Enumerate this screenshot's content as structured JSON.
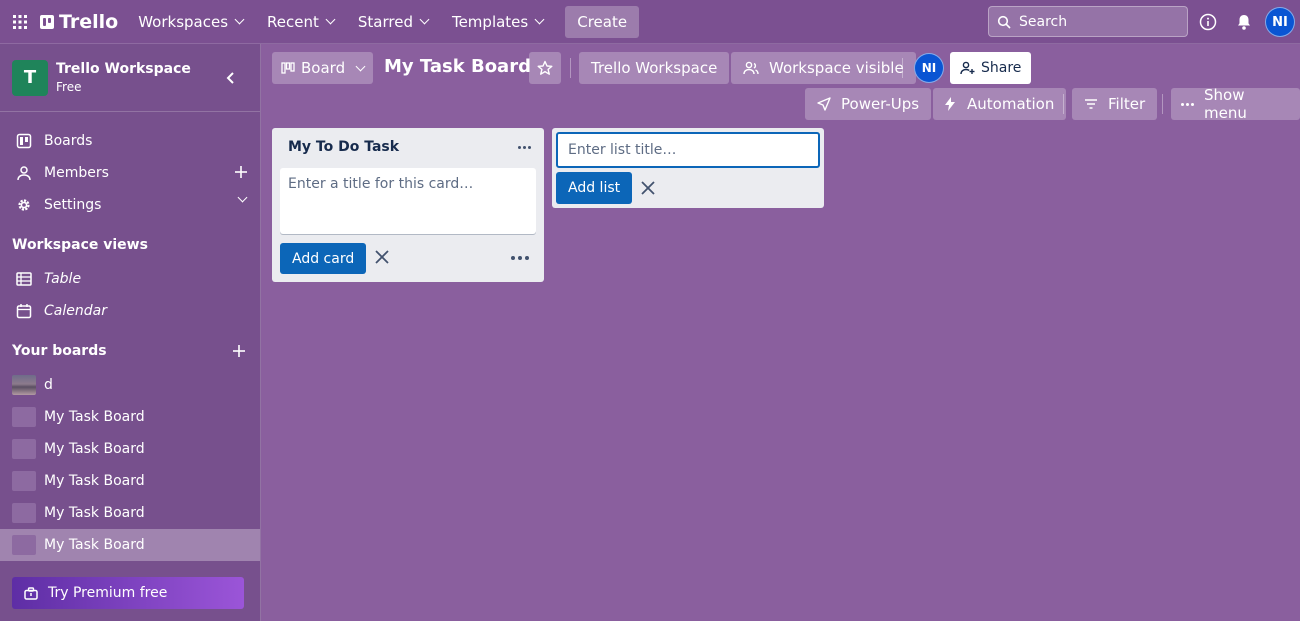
{
  "topnav": {
    "brand": "Trello",
    "menus": [
      "Workspaces",
      "Recent",
      "Starred",
      "Templates"
    ],
    "create_label": "Create",
    "search_placeholder": "Search",
    "avatar_initials": "NI"
  },
  "sidebar": {
    "workspace_initial": "T",
    "workspace_name": "Trello Workspace",
    "workspace_plan": "Free",
    "nav": [
      "Boards",
      "Members",
      "Settings"
    ],
    "views_title": "Workspace views",
    "views": [
      "Table",
      "Calendar"
    ],
    "boards_title": "Your boards",
    "boards": [
      "d",
      "My Task Board",
      "My Task Board",
      "My Task Board",
      "My Task Board",
      "My Task Board"
    ],
    "premium_label": "Try Premium free"
  },
  "board": {
    "view_label": "Board",
    "title": "My Task Board",
    "workspace_label": "Trello Workspace",
    "visibility_label": "Workspace visible",
    "member_initials": "NI",
    "share_label": "Share",
    "powerups_label": "Power-Ups",
    "automation_label": "Automation",
    "filter_label": "Filter",
    "show_menu_label": "Show menu"
  },
  "list": {
    "title": "My To Do Task",
    "card_placeholder": "Enter a title for this card…",
    "add_card_label": "Add card"
  },
  "new_list": {
    "placeholder": "Enter list title…",
    "add_list_label": "Add list"
  },
  "colors": {
    "board_bg": "#8a5f9e",
    "accent": "#0c66b8",
    "workspace_logo": "#1f845a"
  }
}
